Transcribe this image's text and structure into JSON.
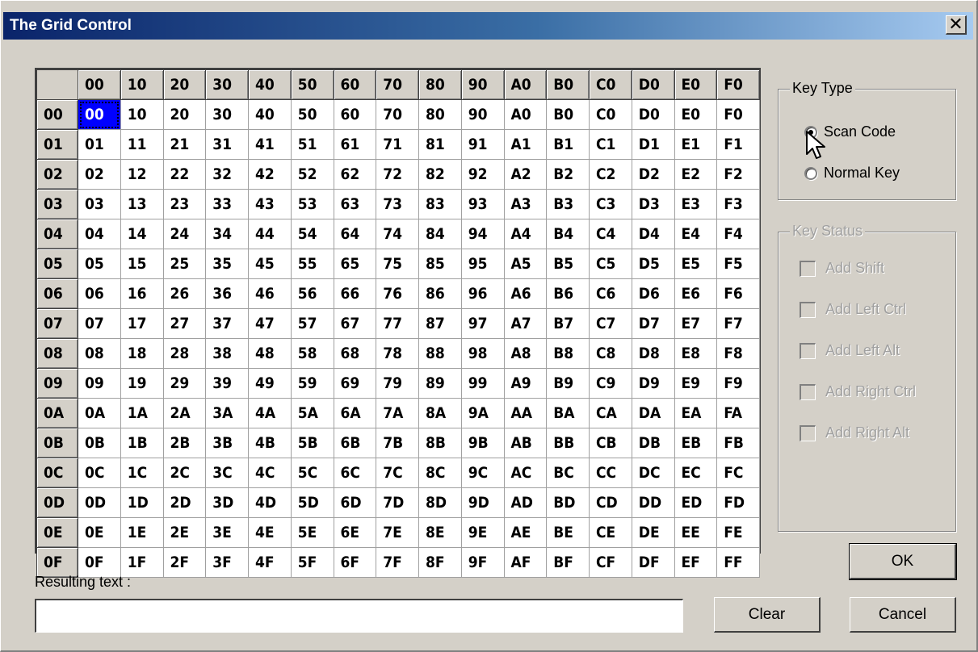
{
  "window": {
    "title": "The Grid Control",
    "close_glyph": "✕"
  },
  "grid": {
    "column_headers": [
      "00",
      "10",
      "20",
      "30",
      "40",
      "50",
      "60",
      "70",
      "80",
      "90",
      "A0",
      "B0",
      "C0",
      "D0",
      "E0",
      "F0"
    ],
    "row_headers": [
      "00",
      "01",
      "02",
      "03",
      "04",
      "05",
      "06",
      "07",
      "08",
      "09",
      "0A",
      "0B",
      "0C",
      "0D",
      "0E",
      "0F"
    ],
    "selected_cell": "00"
  },
  "key_type": {
    "title": "Key Type",
    "options": [
      {
        "label": "Scan Code",
        "selected": true
      },
      {
        "label": "Normal Key",
        "selected": false
      }
    ]
  },
  "key_status": {
    "title": "Key Status",
    "enabled": false,
    "options": [
      {
        "label": "Add Shift",
        "checked": false
      },
      {
        "label": "Add Left Ctrl",
        "checked": false
      },
      {
        "label": "Add Left Alt",
        "checked": false
      },
      {
        "label": "Add Right Ctrl",
        "checked": false
      },
      {
        "label": "Add Right Alt",
        "checked": false
      }
    ]
  },
  "result": {
    "label": "Resulting text :",
    "value": ""
  },
  "buttons": {
    "ok": "OK",
    "clear": "Clear",
    "cancel": "Cancel"
  },
  "colors": {
    "face": "#d4d0c8",
    "selection": "#0000ff",
    "title_start": "#0a246a",
    "title_end": "#a6caf0"
  }
}
